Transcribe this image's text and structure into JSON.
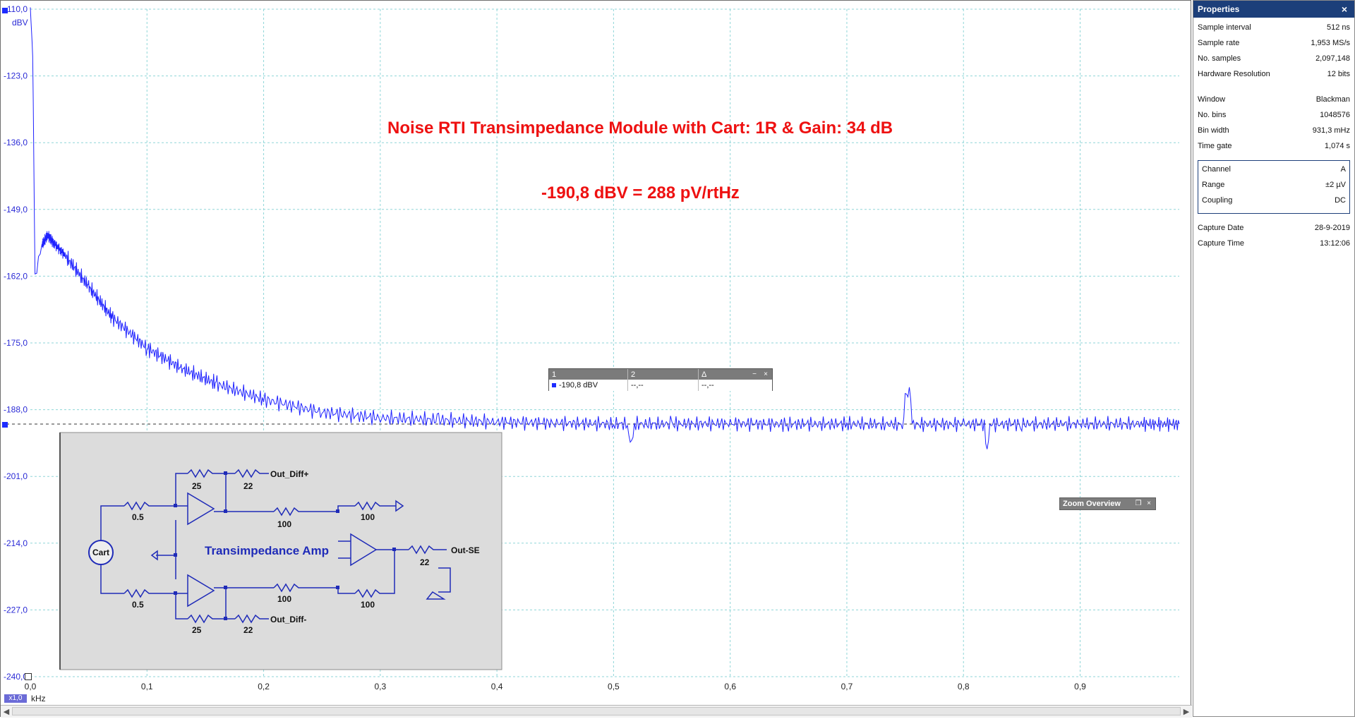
{
  "chart_data": {
    "type": "line",
    "title": "Noise RTI Transimpedance Module with Cart: 1R & Gain: 34 dB",
    "subtitle": "-190,8 dBV = 288 pV/rtHz",
    "ylabel": "dBV",
    "xlabel": "kHz",
    "ylim": [
      -240,
      -110
    ],
    "xlim": [
      0,
      0.985
    ],
    "yticks": [
      "-110,0",
      "-123,0",
      "-136,0",
      "-149,0",
      "-162,0",
      "-175,0",
      "-188,0",
      "-201,0",
      "-214,0",
      "-227,0",
      "-240,0"
    ],
    "xticks": [
      "0,0",
      "0,1",
      "0,2",
      "0,3",
      "0,4",
      "0,5",
      "0,6",
      "0,7",
      "0,8",
      "0,9"
    ],
    "series": [
      {
        "color": "#1f22ff",
        "x": [
          0.0,
          0.002,
          0.004,
          0.01,
          0.015,
          0.02,
          0.03,
          0.05,
          0.07,
          0.1,
          0.13,
          0.16,
          0.2,
          0.25,
          0.3,
          0.35,
          0.4,
          0.45,
          0.5,
          0.55,
          0.6,
          0.65,
          0.7,
          0.75,
          0.8,
          0.85,
          0.9,
          0.95,
          0.985
        ],
        "y": [
          -110.2,
          -118,
          -162,
          -156,
          -154,
          -155.5,
          -158,
          -164,
          -170,
          -176,
          -180,
          -183,
          -186,
          -188.5,
          -189.6,
          -190,
          -190.4,
          -190.6,
          -190.8,
          -190.8,
          -190.7,
          -190.8,
          -190.8,
          -190.9,
          -190.8,
          -190.8,
          -190.8,
          -190.8,
          -190.8
        ]
      }
    ],
    "reference_line": -190.8,
    "grid": true
  },
  "cursor_readout": {
    "header": [
      "1",
      "2",
      "Δ"
    ],
    "values": [
      "-190,8 dBV",
      "--,--",
      "--,--"
    ]
  },
  "zoom_overview": {
    "label": "Zoom Overview"
  },
  "axis_badges": {
    "zoom": "x1,0",
    "x_unit": "kHz"
  },
  "properties": {
    "title": "Properties",
    "rows": [
      {
        "label": "Sample interval",
        "value": "512 ns"
      },
      {
        "label": "Sample rate",
        "value": "1,953 MS/s"
      },
      {
        "label": "No. samples",
        "value": "2,097,148"
      },
      {
        "label": "Hardware Resolution",
        "value": "12 bits"
      },
      {
        "label": "Window",
        "value": "Blackman"
      },
      {
        "label": "No. bins",
        "value": "1048576"
      },
      {
        "label": "Bin width",
        "value": "931,3 mHz"
      },
      {
        "label": "Time gate",
        "value": "1,074 s"
      }
    ],
    "group": [
      {
        "label": "Channel",
        "value": "A"
      },
      {
        "label": "Range",
        "value": "±2 µV"
      },
      {
        "label": "Coupling",
        "value": "DC"
      }
    ],
    "rows2": [
      {
        "label": "Capture Date",
        "value": "28-9-2019"
      },
      {
        "label": "Capture Time",
        "value": "13:12:06"
      }
    ]
  },
  "schematic": {
    "title": "Transimpedance Amp",
    "labels": [
      "Out_Diff+",
      "Out_Diff-",
      "Out-SE",
      "Cart"
    ],
    "resistors": [
      "25",
      "22",
      "0.5",
      "100",
      "100",
      "22",
      "0.5",
      "100",
      "100",
      "25",
      "22"
    ]
  },
  "icons": {
    "close": "close-icon",
    "minimize": "minimize-icon",
    "restore": "restore-icon",
    "left": "chevron-left-icon",
    "right": "chevron-right-icon"
  },
  "colors": {
    "trace": "#1f22ff",
    "grid": "#8fd6d8",
    "title": "#ee1111",
    "panel_header": "#1c3f7a"
  }
}
